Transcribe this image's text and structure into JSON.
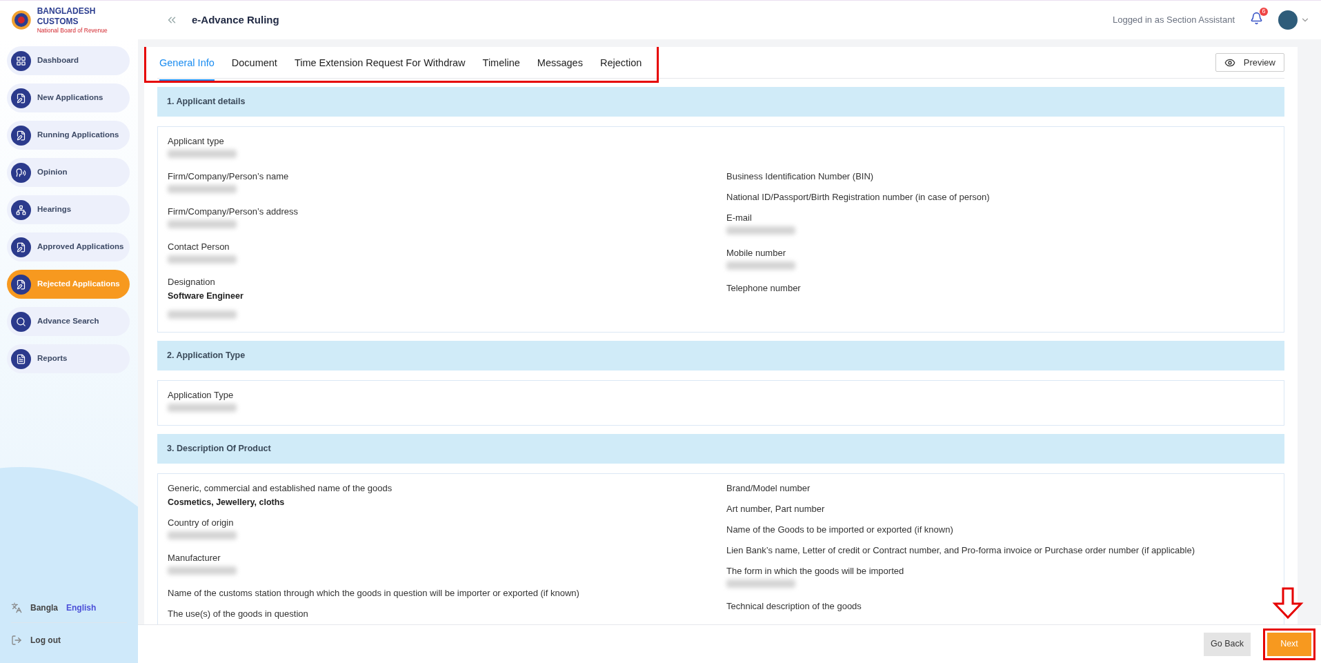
{
  "brand": {
    "name": "BANGLADESH CUSTOMS",
    "subtitle": "National Board of Revenue"
  },
  "header": {
    "title": "e-Advance Ruling",
    "user_text": "Logged in as Section Assistant",
    "notification_count": "6"
  },
  "sidebar": {
    "items": [
      {
        "label": "Dashboard",
        "selected": false
      },
      {
        "label": "New Applications",
        "selected": false
      },
      {
        "label": "Running Applications",
        "selected": false
      },
      {
        "label": "Opinion",
        "selected": false
      },
      {
        "label": "Hearings",
        "selected": false
      },
      {
        "label": "Approved Applications",
        "selected": false
      },
      {
        "label": "Rejected Applications",
        "selected": true
      },
      {
        "label": "Advance Search",
        "selected": false
      },
      {
        "label": "Reports",
        "selected": false
      }
    ]
  },
  "language": {
    "options": [
      {
        "label": "Bangla",
        "selected": false
      },
      {
        "label": "English",
        "selected": true
      }
    ]
  },
  "logout": "Log out",
  "tabs": {
    "highlighted": true,
    "items": [
      {
        "label": "General Info",
        "selected": true
      },
      {
        "label": "Document",
        "selected": false
      },
      {
        "label": "Time Extension Request For Withdraw",
        "selected": false
      },
      {
        "label": "Timeline",
        "selected": false
      },
      {
        "label": "Messages",
        "selected": false
      },
      {
        "label": "Rejection",
        "selected": false
      }
    ]
  },
  "preview_button": "Preview",
  "sections": [
    {
      "title": "1. Applicant details",
      "columns": [
        [
          {
            "label": "Applicant type",
            "redacted": true
          },
          {
            "label": "Firm/Company/Person’s name",
            "redacted": true
          },
          {
            "label": "Firm/Company/Person’s address",
            "redacted": true
          },
          {
            "label": "Contact Person",
            "redacted": true
          },
          {
            "label": "Designation",
            "value": "Software Engineer"
          },
          {
            "redacted": true
          }
        ],
        [
          {
            "label": "Business Identification Number (BIN)"
          },
          {
            "label": "National ID/Passport/Birth Registration number (in case of person)"
          },
          {
            "label": "E-mail",
            "redacted": true
          },
          {
            "label": "Mobile number",
            "redacted": true
          },
          {
            "label": "Telephone number"
          }
        ]
      ]
    },
    {
      "title": "2. Application Type",
      "columns": [
        [
          {
            "label": "Application Type",
            "redacted": true
          }
        ]
      ]
    },
    {
      "title": "3. Description Of Product",
      "columns": [
        [
          {
            "label": "Generic, commercial and established name of the goods",
            "value": "Cosmetics, Jewellery, cloths"
          },
          {
            "label": "Country of origin",
            "redacted": true
          },
          {
            "label": "Manufacturer",
            "redacted": true
          },
          {
            "label": "Name of the customs station through which the goods in question will be importer or exported (if known)"
          },
          {
            "label": "The use(s) of the goods in question"
          }
        ],
        [
          {
            "label": "Brand/Model number"
          },
          {
            "label": "Art number, Part number"
          },
          {
            "label": "Name of the Goods to be imported or exported (if known)"
          },
          {
            "label": "Lien Bank’s name, Letter of credit or Contract number, and Pro-forma invoice or Purchase order number (if applicable)"
          },
          {
            "label": "The form in which the goods will be imported",
            "redacted": true
          },
          {
            "label": "Technical description of the goods"
          }
        ]
      ]
    }
  ],
  "footer": {
    "arrow": true,
    "buttons": [
      {
        "label": "Go Back",
        "kind": "secondary",
        "highlighted": false
      },
      {
        "label": "Next",
        "kind": "primary",
        "highlighted": true
      }
    ]
  }
}
